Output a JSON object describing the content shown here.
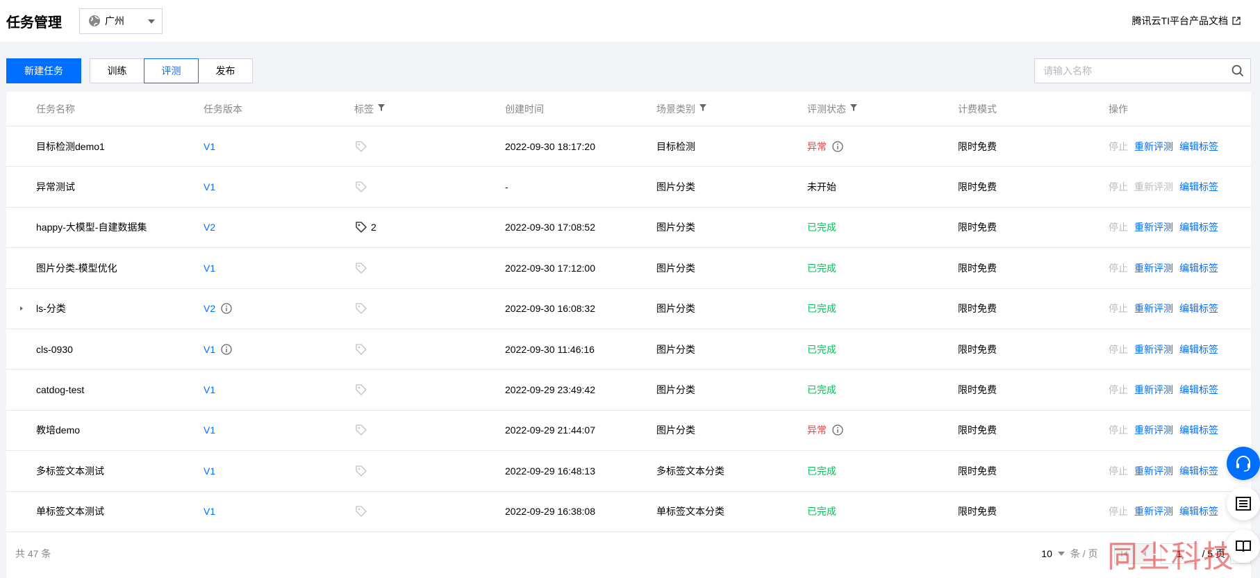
{
  "header": {
    "title": "任务管理",
    "region": "广州",
    "doc_link": "腾讯云TI平台产品文档"
  },
  "toolbar": {
    "new_task": "新建任务",
    "tabs": [
      {
        "label": "训练",
        "active": false
      },
      {
        "label": "评测",
        "active": true
      },
      {
        "label": "发布",
        "active": false
      }
    ],
    "search_placeholder": "请输入名称"
  },
  "table": {
    "columns": [
      "任务名称",
      "任务版本",
      "标签",
      "创建时间",
      "场景类别",
      "评测状态",
      "计费模式",
      "操作"
    ],
    "rows": [
      {
        "name": "目标检测demo1",
        "version": "V1",
        "version_info": false,
        "tag_count": "",
        "created": "2022-09-30 18:17:20",
        "scene": "目标检测",
        "status": "异常",
        "status_type": "err",
        "billing": "限时免费",
        "op_stop": "停止",
        "op_reeval": "重新评测",
        "op_reeval_enabled": true,
        "op_edit": "编辑标签",
        "expandable": false
      },
      {
        "name": "异常测试",
        "version": "V1",
        "version_info": false,
        "tag_count": "",
        "created": "-",
        "scene": "图片分类",
        "status": "未开始",
        "status_type": "plain",
        "billing": "限时免费",
        "op_stop": "停止",
        "op_reeval": "重新评测",
        "op_reeval_enabled": false,
        "op_edit": "编辑标签",
        "expandable": false
      },
      {
        "name": "happy-大模型-自建数据集",
        "version": "V2",
        "version_info": false,
        "tag_count": "2",
        "created": "2022-09-30 17:08:52",
        "scene": "图片分类",
        "status": "已完成",
        "status_type": "ok",
        "billing": "限时免费",
        "op_stop": "停止",
        "op_reeval": "重新评测",
        "op_reeval_enabled": true,
        "op_edit": "编辑标签",
        "expandable": false
      },
      {
        "name": "图片分类-模型优化",
        "version": "V1",
        "version_info": false,
        "tag_count": "",
        "created": "2022-09-30 17:12:00",
        "scene": "图片分类",
        "status": "已完成",
        "status_type": "ok",
        "billing": "限时免费",
        "op_stop": "停止",
        "op_reeval": "重新评测",
        "op_reeval_enabled": true,
        "op_edit": "编辑标签",
        "expandable": false
      },
      {
        "name": "ls-分类",
        "version": "V2",
        "version_info": true,
        "tag_count": "",
        "created": "2022-09-30 16:08:32",
        "scene": "图片分类",
        "status": "已完成",
        "status_type": "ok",
        "billing": "限时免费",
        "op_stop": "停止",
        "op_reeval": "重新评测",
        "op_reeval_enabled": true,
        "op_edit": "编辑标签",
        "expandable": true
      },
      {
        "name": "cls-0930",
        "version": "V1",
        "version_info": true,
        "tag_count": "",
        "created": "2022-09-30 11:46:16",
        "scene": "图片分类",
        "status": "已完成",
        "status_type": "ok",
        "billing": "限时免费",
        "op_stop": "停止",
        "op_reeval": "重新评测",
        "op_reeval_enabled": true,
        "op_edit": "编辑标签",
        "expandable": false
      },
      {
        "name": "catdog-test",
        "version": "V1",
        "version_info": false,
        "tag_count": "",
        "created": "2022-09-29 23:49:42",
        "scene": "图片分类",
        "status": "已完成",
        "status_type": "ok",
        "billing": "限时免费",
        "op_stop": "停止",
        "op_reeval": "重新评测",
        "op_reeval_enabled": true,
        "op_edit": "编辑标签",
        "expandable": false
      },
      {
        "name": "教培demo",
        "version": "V1",
        "version_info": false,
        "tag_count": "",
        "created": "2022-09-29 21:44:07",
        "scene": "图片分类",
        "status": "异常",
        "status_type": "err",
        "billing": "限时免费",
        "op_stop": "停止",
        "op_reeval": "重新评测",
        "op_reeval_enabled": true,
        "op_edit": "编辑标签",
        "expandable": false
      },
      {
        "name": "多标签文本测试",
        "version": "V1",
        "version_info": false,
        "tag_count": "",
        "created": "2022-09-29 16:48:13",
        "scene": "多标签文本分类",
        "status": "已完成",
        "status_type": "ok",
        "billing": "限时免费",
        "op_stop": "停止",
        "op_reeval": "重新评测",
        "op_reeval_enabled": true,
        "op_edit": "编辑标签",
        "expandable": false
      },
      {
        "name": "单标签文本测试",
        "version": "V1",
        "version_info": false,
        "tag_count": "",
        "created": "2022-09-29 16:38:08",
        "scene": "单标签文本分类",
        "status": "已完成",
        "status_type": "ok",
        "billing": "限时免费",
        "op_stop": "停止",
        "op_reeval": "重新评测",
        "op_reeval_enabled": true,
        "op_edit": "编辑标签",
        "expandable": false
      }
    ]
  },
  "footer": {
    "total": "共 47 条",
    "page_size": "10",
    "per_page": "条 / 页",
    "current_page": "1",
    "total_pages": "/ 5 页"
  },
  "watermark": "同尘科技",
  "colors": {
    "primary": "#006eff",
    "success": "#0abf5b",
    "error": "#e54545",
    "muted": "#bbbbbb"
  }
}
